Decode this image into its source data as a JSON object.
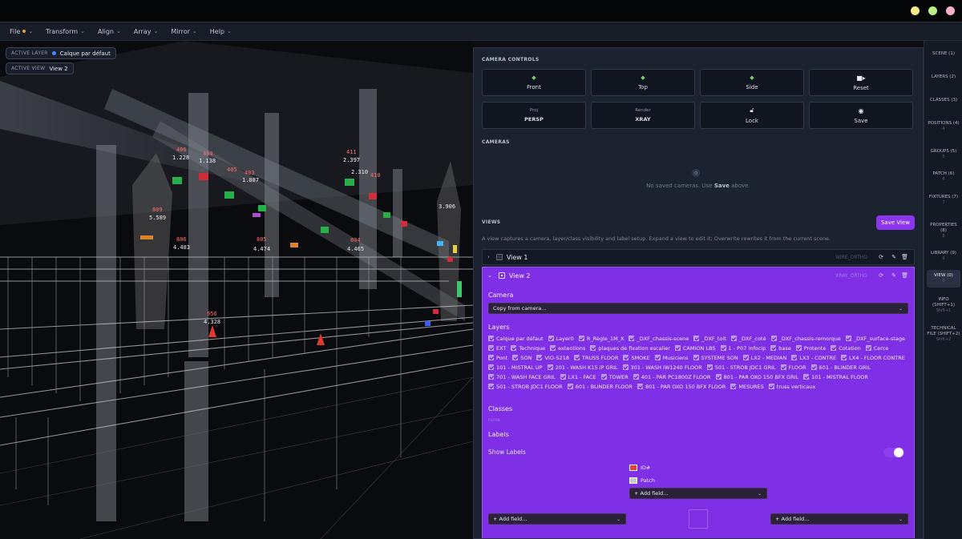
{
  "menubar": {
    "items": [
      {
        "label": "File",
        "dot": true
      },
      {
        "label": "Transform"
      },
      {
        "label": "Align"
      },
      {
        "label": "Array"
      },
      {
        "label": "Mirror"
      },
      {
        "label": "Help"
      }
    ]
  },
  "viewport": {
    "active_layer_key": "ACTIVE LAYER",
    "active_layer_value": "Calque par défaut",
    "active_view_key": "ACTIVE VIEW",
    "active_view_value": "View 2",
    "labels": [
      {
        "id": "406",
        "val": "1.228"
      },
      {
        "id": "404",
        "val": "1.138"
      },
      {
        "id": "405",
        "val": ""
      },
      {
        "id": "403",
        "val": "1.087"
      },
      {
        "id": "411",
        "val": "2.397"
      },
      {
        "id": "410",
        "val": "2.310"
      },
      {
        "id": "809",
        "val": "5.589"
      },
      {
        "id": "806",
        "val": "4.483"
      },
      {
        "id": "805",
        "val": "4.474"
      },
      {
        "id": "804",
        "val": "4.465"
      },
      {
        "id": "956",
        "val": "4.328"
      },
      {
        "id": "",
        "val": "3.906"
      }
    ]
  },
  "camera_controls": {
    "title": "CAMERA CONTROLS",
    "buttons": [
      {
        "label": "Front",
        "icon": "front-view-icon"
      },
      {
        "label": "Top",
        "icon": "top-view-icon"
      },
      {
        "label": "Side",
        "icon": "side-view-icon"
      },
      {
        "label": "Reset",
        "icon": "video-camera-icon"
      },
      {
        "small": "Proj",
        "label": "PERSP"
      },
      {
        "small": "Render",
        "label": "XRAY"
      },
      {
        "label": "Lock",
        "icon": "lock-icon"
      },
      {
        "label": "Save",
        "icon": "camera-icon"
      }
    ]
  },
  "cameras": {
    "title": "CAMERAS",
    "empty_pre": "No saved cameras. Use ",
    "empty_bold": "Save",
    "empty_post": " above."
  },
  "views": {
    "title": "VIEWS",
    "save_label": "Save View",
    "description": "A view captures a camera, layer/class visibility and label setup. Expand a view to edit it; Overwrite rewrites it from the current scene.",
    "view1": {
      "name": "View 1",
      "mode": "WIRE_ORTHO"
    },
    "view2": {
      "name": "View 2",
      "mode": "XRAY_ORTHO",
      "camera_label": "Camera",
      "camera_select": "Copy from camera...",
      "layers_label": "Layers",
      "layers": [
        "Calque par défaut",
        "Layer0",
        "R_Règle_1M_X",
        "_DXF_chassis-scene",
        "_DXF_toit",
        "_DXF_coté",
        "_DXF_chassis-remorque",
        "_DXF_surface-stage",
        "EXT",
        "Technique",
        "extentions",
        "plaques de fixation escalier",
        "CAMION LBS",
        "1 - P07 Infocip",
        "base",
        "Protente",
        "Cotation",
        "Cerce",
        "Pont",
        "SON",
        "VIO-S218",
        "TRUSS FLOOR",
        "SMOKE",
        "Musiciens",
        "SYSTEME SON",
        "LX2 - MEDIAN",
        "LX3 - CONTRE",
        "LX4 - FLOOR CONTRE",
        "101 - MISTRAL UP",
        "201 - WASH K15 iP GRIL",
        "301 - WASH iW1240 FLOOR",
        "501 - STROB JDC1 GRIL",
        "FLOOR",
        "601 - BLINDER GRIL",
        "701 - WASH FACE GRIL",
        "LX1 - FACE",
        "TOWER",
        "401 - PAR PC1800Z FLOOR",
        "801 - PAR OXO 150 BFX GRIL",
        "101 - MISTRAL FLOOR",
        "501 - STROB JDC1 FLOOR",
        "601 - BLINDER FLOOR",
        "801 - PAR OXO 150 BFX FLOOR",
        "MESURES",
        "truss verticaux"
      ],
      "classes_label": "Classes",
      "classes_empty": "none",
      "labels_label": "Labels",
      "show_labels": "Show Labels",
      "fields": [
        {
          "name": "ID#",
          "color": "#e0403a"
        },
        {
          "name": "Patch",
          "color": "#c8c8c8"
        }
      ],
      "add_field": "+ Add field..."
    }
  },
  "rail": [
    {
      "label": "SCENE (1)",
      "sub": ""
    },
    {
      "label": "LAYERS (2)",
      "sub": ""
    },
    {
      "label": "CLASSES (3)",
      "sub": ""
    },
    {
      "label": "POSITIONS (4)",
      "sub": "4"
    },
    {
      "label": "GROUPS (5)",
      "sub": "5"
    },
    {
      "label": "PATCH (6)",
      "sub": "6"
    },
    {
      "label": "FIXTURES (7)",
      "sub": "7"
    },
    {
      "label": "PROPERTIES (8)",
      "sub": "8"
    },
    {
      "label": "LIBRARY (9)",
      "sub": "9"
    },
    {
      "label": "VIEW (0)",
      "sub": "0"
    },
    {
      "label": "INFO (SHIFT+1)",
      "sub": "Shift+1"
    },
    {
      "label": "TECHNICAL FILE (SHIFT+2)",
      "sub": "Shift+2"
    }
  ],
  "colors": {
    "accent": "#8b35ee",
    "view_bg": "#7f2fe6",
    "panel": "#1b2230"
  }
}
